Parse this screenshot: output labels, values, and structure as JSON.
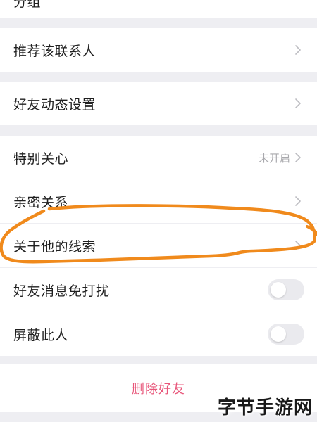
{
  "top_partial_label": "分组",
  "groups": {
    "recommend": {
      "label": "推荐该联系人",
      "chevron": "chevron-right-icon"
    },
    "moments": {
      "label": "好友动态设置",
      "chevron": "chevron-right-icon"
    },
    "special_care": {
      "label": "特别关心",
      "value": "未开启",
      "chevron": "chevron-right-icon"
    },
    "intimate": {
      "label": "亲密关系",
      "chevron": "chevron-right-icon"
    },
    "clues": {
      "label": "关于他的线索",
      "chevron": "chevron-right-icon"
    },
    "mute": {
      "label": "好友消息免打扰",
      "toggle_on": false
    },
    "block": {
      "label": "屏蔽此人",
      "toggle_on": false
    }
  },
  "delete_button": {
    "label": "删除好友"
  },
  "annotation": {
    "color": "#f08a1c",
    "shape": "freehand-circle"
  },
  "watermark": {
    "text": "字节手游网"
  },
  "colors": {
    "background": "#eeeef2",
    "delete_text": "#e8567a",
    "secondary_text": "#a9a9ad"
  }
}
